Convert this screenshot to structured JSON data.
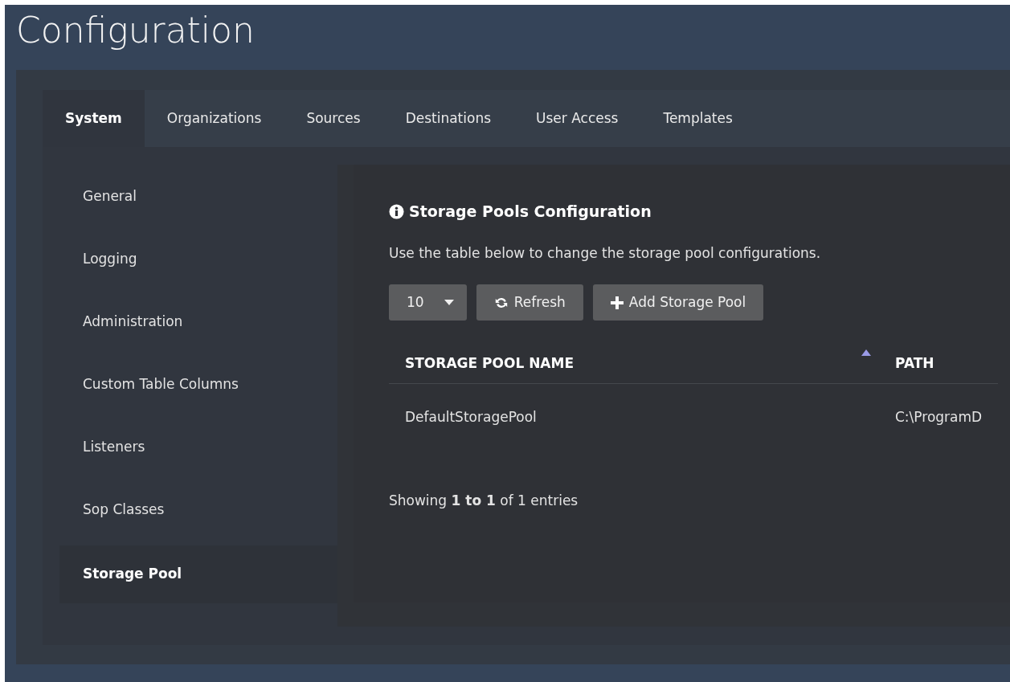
{
  "page_title": "Configuration",
  "tabs": [
    {
      "label": "System",
      "selected": true
    },
    {
      "label": "Organizations",
      "selected": false
    },
    {
      "label": "Sources",
      "selected": false
    },
    {
      "label": "Destinations",
      "selected": false
    },
    {
      "label": "User Access",
      "selected": false
    },
    {
      "label": "Templates",
      "selected": false
    }
  ],
  "sidebar": {
    "items": [
      {
        "label": "General",
        "selected": false
      },
      {
        "label": "Logging",
        "selected": false
      },
      {
        "label": "Administration",
        "selected": false
      },
      {
        "label": "Custom Table Columns",
        "selected": false
      },
      {
        "label": "Listeners",
        "selected": false
      },
      {
        "label": "Sop Classes",
        "selected": false
      },
      {
        "label": "Storage Pool",
        "selected": true
      }
    ]
  },
  "panel": {
    "title": "Storage Pools Configuration",
    "description": "Use the table below to change the storage pool configurations.",
    "page_size": "10",
    "buttons": [
      {
        "kind": "refresh",
        "label": "Refresh"
      },
      {
        "kind": "add",
        "label": "Add Storage Pool"
      }
    ],
    "table": {
      "columns": [
        {
          "label": "STORAGE POOL NAME",
          "sorted": true
        },
        {
          "label": "PATH"
        }
      ],
      "rows": [
        [
          "DefaultStoragePool",
          "C:\\ProgramD"
        ]
      ]
    },
    "info": "Showing **1 to 1** of 1 entries"
  }
}
